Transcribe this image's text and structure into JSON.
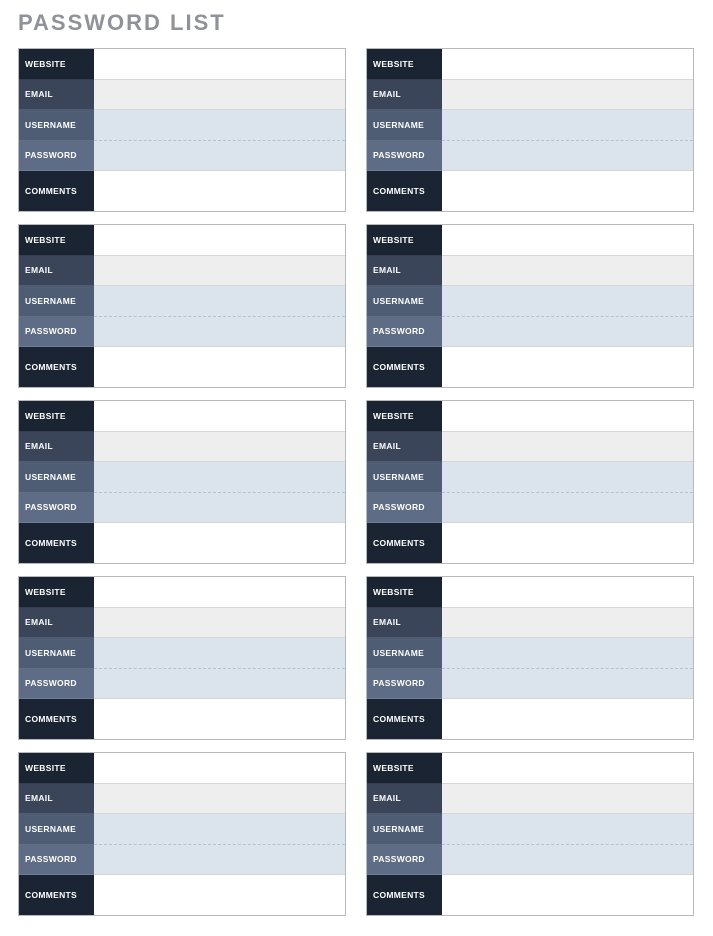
{
  "title": "PASSWORD LIST",
  "labels": {
    "website": "WEBSITE",
    "email": "EMAIL",
    "username": "USERNAME",
    "password": "PASSWORD",
    "comments": "COMMENTS"
  },
  "entries": [
    {
      "website": "",
      "email": "",
      "username": "",
      "password": "",
      "comments": ""
    },
    {
      "website": "",
      "email": "",
      "username": "",
      "password": "",
      "comments": ""
    },
    {
      "website": "",
      "email": "",
      "username": "",
      "password": "",
      "comments": ""
    },
    {
      "website": "",
      "email": "",
      "username": "",
      "password": "",
      "comments": ""
    },
    {
      "website": "",
      "email": "",
      "username": "",
      "password": "",
      "comments": ""
    },
    {
      "website": "",
      "email": "",
      "username": "",
      "password": "",
      "comments": ""
    },
    {
      "website": "",
      "email": "",
      "username": "",
      "password": "",
      "comments": ""
    },
    {
      "website": "",
      "email": "",
      "username": "",
      "password": "",
      "comments": ""
    },
    {
      "website": "",
      "email": "",
      "username": "",
      "password": "",
      "comments": ""
    },
    {
      "website": "",
      "email": "",
      "username": "",
      "password": "",
      "comments": ""
    }
  ]
}
